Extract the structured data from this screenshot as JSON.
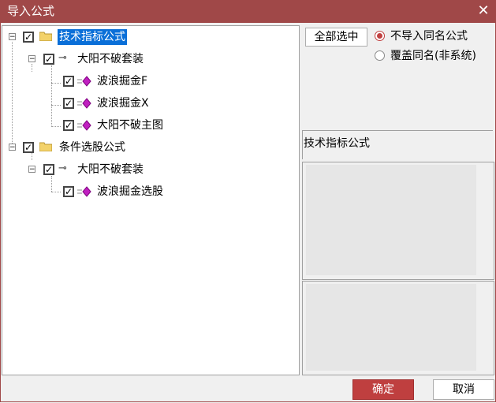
{
  "window": {
    "title": "导入公式",
    "close_symbol": "✕"
  },
  "tree": {
    "groups": [
      {
        "label": "技术指标公式",
        "checked": true,
        "selected": true,
        "children": [
          {
            "label": "大阳不破套装",
            "checked": true,
            "children": [
              {
                "label": "波浪掘金F",
                "checked": true
              },
              {
                "label": "波浪掘金X",
                "checked": true
              },
              {
                "label": "大阳不破主图",
                "checked": true
              }
            ]
          }
        ]
      },
      {
        "label": "条件选股公式",
        "checked": true,
        "selected": false,
        "children": [
          {
            "label": "大阳不破套装",
            "checked": true,
            "children": [
              {
                "label": "波浪掘金选股",
                "checked": true
              }
            ]
          }
        ]
      }
    ]
  },
  "options": {
    "select_all_label": "全部选中",
    "radios": [
      {
        "label": "不导入同名公式",
        "selected": true
      },
      {
        "label": "覆盖同名(非系统)",
        "selected": false
      }
    ]
  },
  "detail": {
    "formula_name": "技术指标公式"
  },
  "footer": {
    "ok_label": "确定",
    "cancel_label": "取消"
  },
  "colors": {
    "titlebar": "#a04848",
    "accent": "#bf3f3f",
    "selection": "#0a6fd8",
    "gem": "#c020c0"
  }
}
